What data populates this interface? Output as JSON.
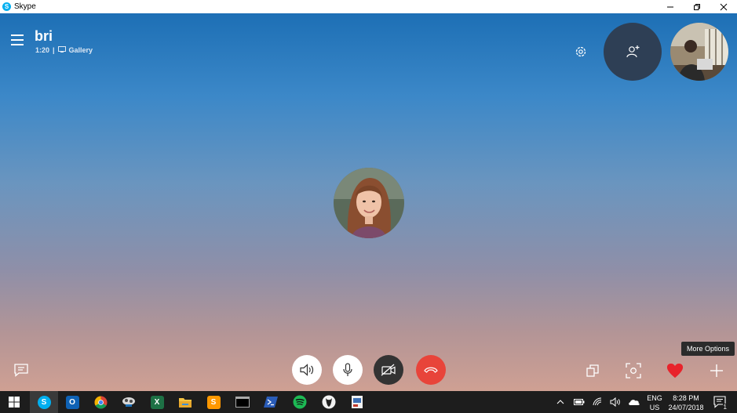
{
  "window": {
    "title": "Skype"
  },
  "call": {
    "contact_name": "bri",
    "duration": "1:20",
    "separator": "|",
    "view_mode": "Gallery",
    "tooltip": "More Options"
  },
  "colors": {
    "hangup": "#e8443a",
    "heart": "#e8232b",
    "accent": "#00aff0"
  },
  "controls": [
    "speaker-icon",
    "microphone-icon",
    "video-off-icon",
    "hang-up-icon"
  ],
  "taskbar": {
    "apps": [
      "windows-start-icon",
      "skype-icon",
      "outlook-icon",
      "chrome-icon",
      "app-icon",
      "excel-icon",
      "file-explorer-icon",
      "sublime-text-icon",
      "terminal-icon",
      "powershell-icon",
      "spotify-icon",
      "app-icon",
      "app-icon"
    ],
    "language": "ENG",
    "region": "US",
    "time": "8:28 PM",
    "date": "24/07/2018",
    "notifications": "1"
  }
}
